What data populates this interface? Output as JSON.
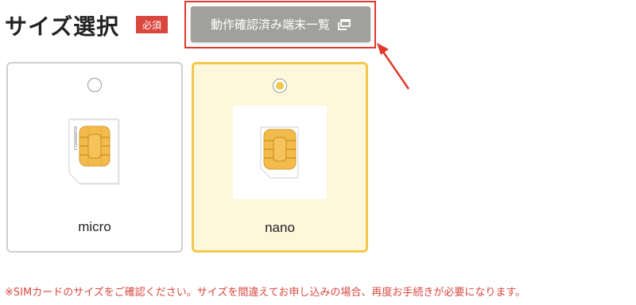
{
  "header": {
    "title": "サイズ選択",
    "required_badge": "必須",
    "device_list_button": "動作確認済み端末一覧",
    "button_icon": "external-window-icon",
    "annotation_color": "#e0392b"
  },
  "options": [
    {
      "label": "micro",
      "selected": false,
      "chip_text": "0180000012"
    },
    {
      "label": "nano",
      "selected": true
    }
  ],
  "colors": {
    "selected_border": "#f2c94c",
    "selected_background": "#fef7dc",
    "button_background": "#a0a09d",
    "notice_text": "#d9473f"
  },
  "notice": "※SIMカードのサイズをご確認ください。サイズを間違えてお申し込みの場合、再度お手続きが必要になります。"
}
